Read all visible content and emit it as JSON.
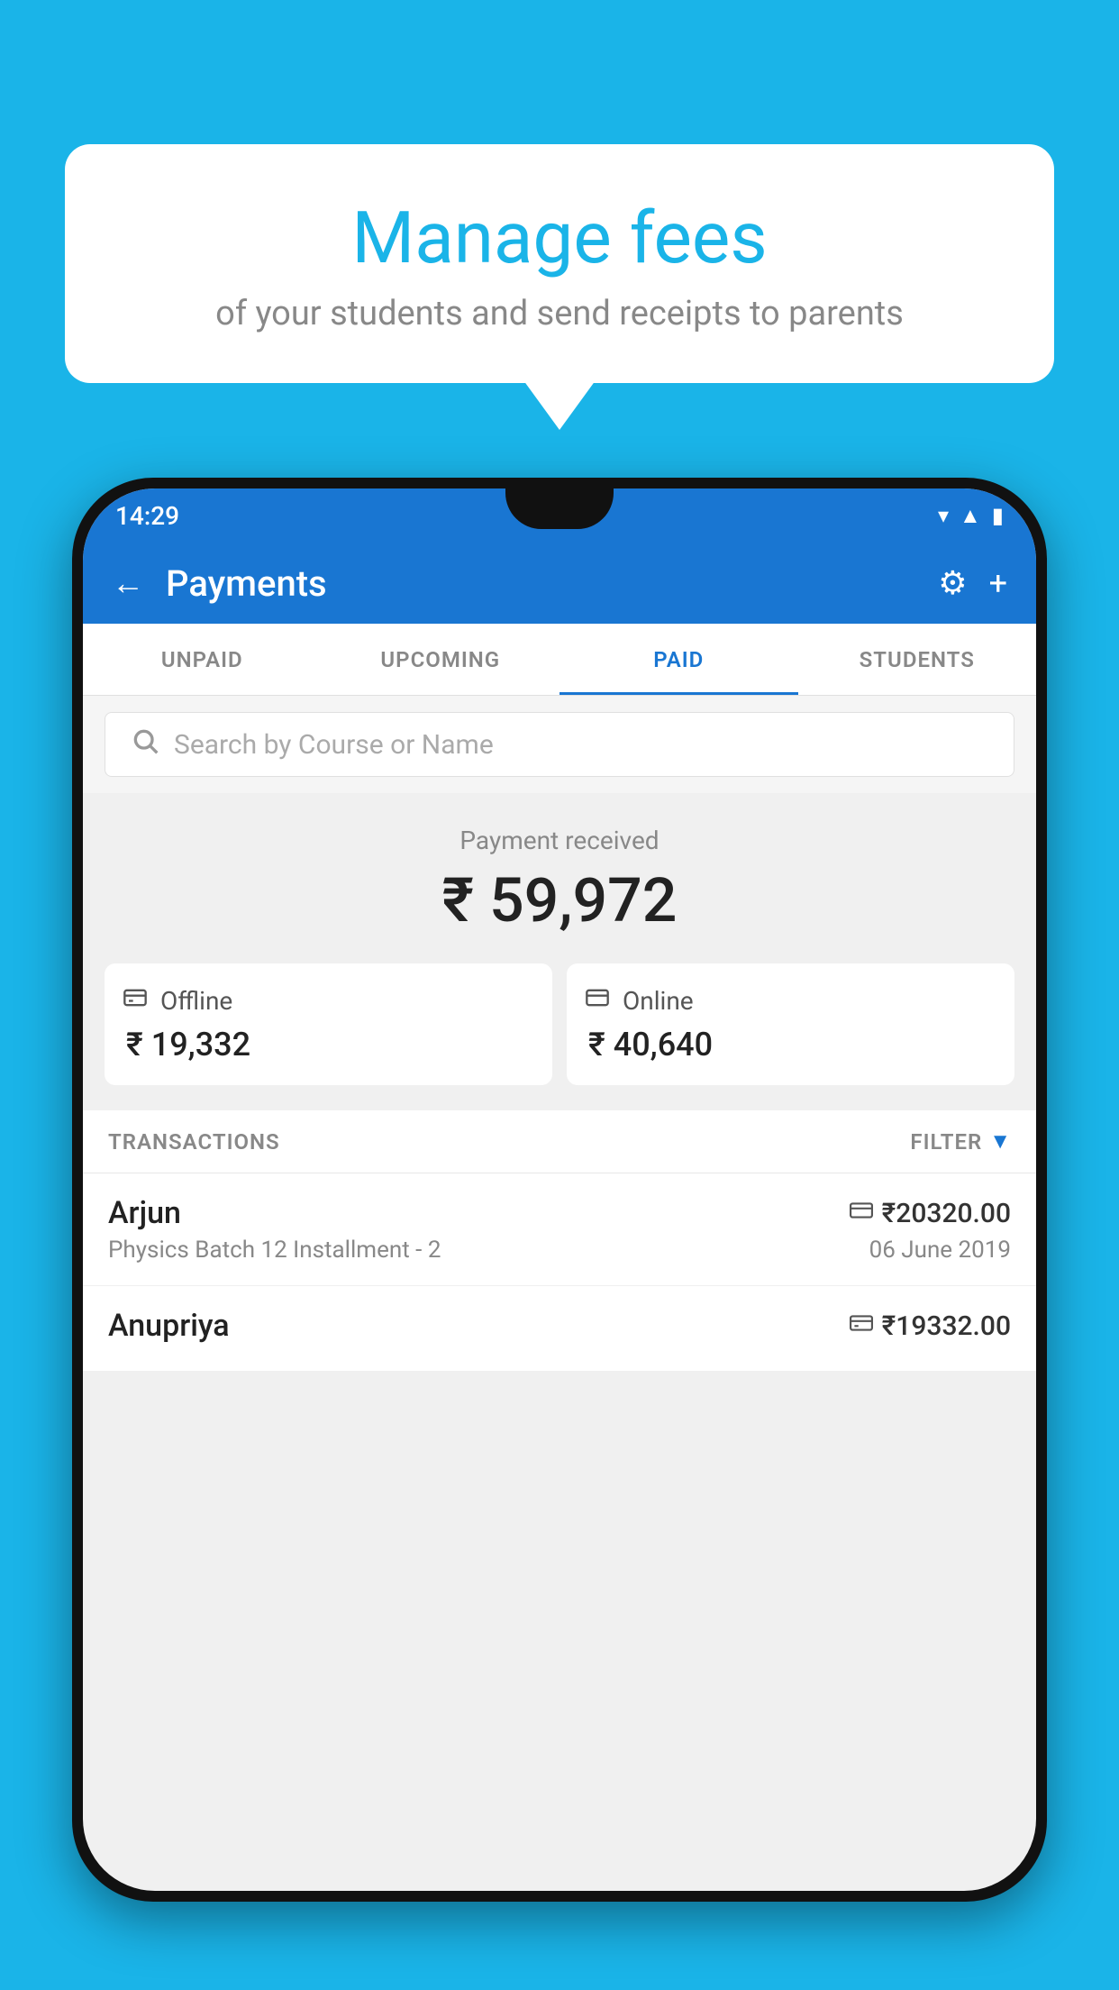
{
  "background_color": "#1ab4e8",
  "bubble": {
    "title": "Manage fees",
    "subtitle": "of your students and send receipts to parents"
  },
  "status_bar": {
    "time": "14:29"
  },
  "app_bar": {
    "title": "Payments",
    "back_icon": "←",
    "settings_icon": "⚙",
    "add_icon": "+"
  },
  "tabs": [
    {
      "label": "UNPAID",
      "active": false
    },
    {
      "label": "UPCOMING",
      "active": false
    },
    {
      "label": "PAID",
      "active": true
    },
    {
      "label": "STUDENTS",
      "active": false
    }
  ],
  "search": {
    "placeholder": "Search by Course or Name"
  },
  "payment": {
    "label": "Payment received",
    "amount": "₹ 59,972",
    "offline": {
      "label": "Offline",
      "amount": "₹ 19,332"
    },
    "online": {
      "label": "Online",
      "amount": "₹ 40,640"
    }
  },
  "transactions_header": {
    "label": "TRANSACTIONS",
    "filter_label": "FILTER"
  },
  "transactions": [
    {
      "name": "Arjun",
      "course": "Physics Batch 12 Installment - 2",
      "amount": "₹20320.00",
      "date": "06 June 2019",
      "payment_type": "online"
    },
    {
      "name": "Anupriya",
      "course": "",
      "amount": "₹19332.00",
      "date": "",
      "payment_type": "offline"
    }
  ]
}
